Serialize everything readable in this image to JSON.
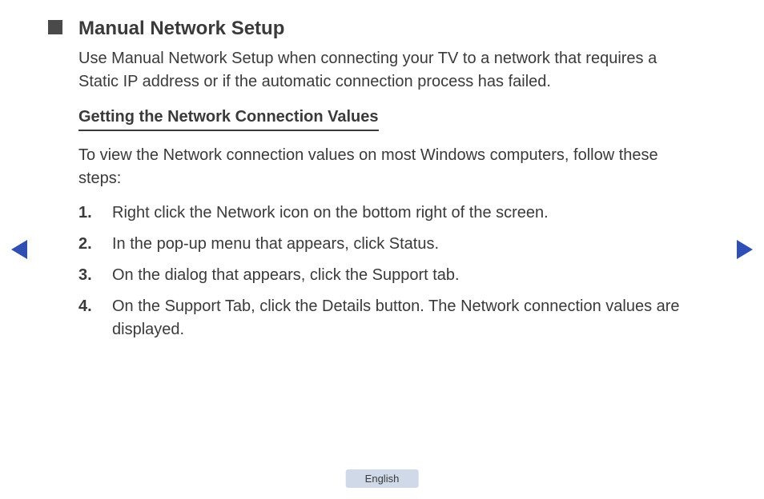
{
  "header": {
    "title": "Manual Network Setup",
    "intro": "Use Manual Network Setup when connecting your TV to a network that requires a Static IP address or if the automatic connection process has failed."
  },
  "section": {
    "subheading": "Getting the Network Connection Values",
    "lead": "To view the Network connection values on most Windows computers, follow these steps:",
    "steps": [
      "Right click the Network icon on the bottom right of the screen.",
      "In the pop-up menu that appears, click Status.",
      "On the dialog that appears, click the Support tab.",
      "On the Support Tab, click the Details button. The Network connection values are displayed."
    ]
  },
  "footer": {
    "language": "English"
  }
}
